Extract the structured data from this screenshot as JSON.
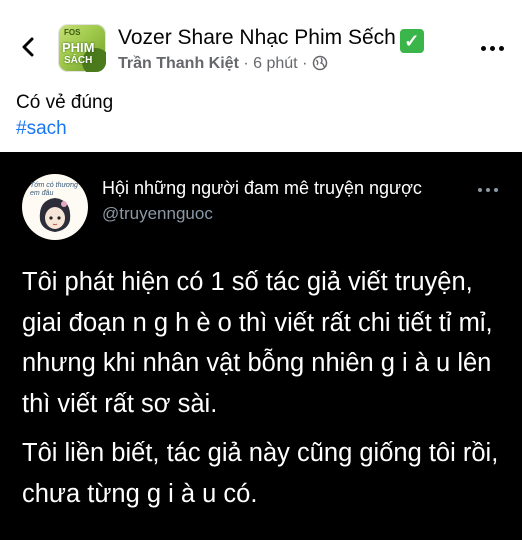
{
  "header": {
    "group_name": "Vozer Share Nhạc Phim Sếch",
    "verified_icon": "check-mark-icon",
    "author": "Trần Thanh Kiệt",
    "separator": "·",
    "time": "6 phút",
    "separator2": "·",
    "privacy_icon": "globe-icon",
    "group_avatar_text": [
      "FOS",
      "PHIM",
      "SÁCH"
    ]
  },
  "post": {
    "caption": "Có vẻ đúng",
    "hashtag": "#sach"
  },
  "tweet": {
    "name": "Hội những người đam mê truyện ngược",
    "handle": "@truyennguoc",
    "avatar_text": "Tớm có thương em đâu",
    "paragraphs": [
      "Tôi phát hiện có 1 số tác giả viết truyện, giai đoạn n g h è o thì viết rất chi tiết tỉ mỉ, nhưng khi nhân vật bỗng nhiên g i à u lên thì viết rất sơ sài.",
      "Tôi liền biết, tác giả này cũng giống tôi rồi, chưa từng g i à u có."
    ]
  },
  "colors": {
    "link": "#1877f2",
    "secondary_text": "#65676b",
    "tweet_bg": "#000000",
    "tweet_handle": "#8b98a5",
    "verified": "#3ab54a"
  }
}
